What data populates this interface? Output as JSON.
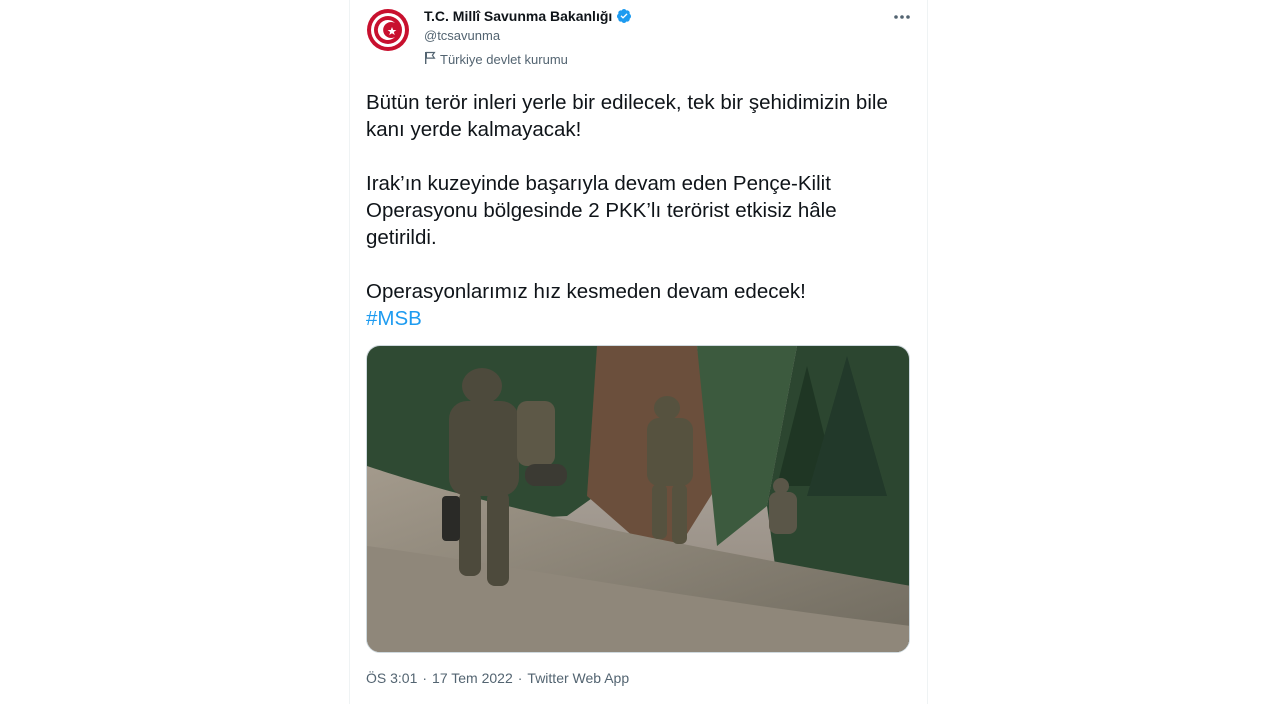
{
  "author": {
    "name": "T.C. Millî Savunma Bakanlığı",
    "handle": "@tcsavunma",
    "affiliation": "Türkiye devlet kurumu",
    "verified": true,
    "avatar_color": "#c8102e"
  },
  "tweet": {
    "paragraphs": [
      "Bütün terör inleri yerle bir edilecek, tek bir şehidimizin bile kanı yerde kalmayacak!",
      "Irak’ın kuzeyinde başarıyla devam eden Pençe-Kilit Operasyonu bölgesinde 2 PKK’lı terörist etkisiz hâle getirildi.",
      "Operasyonlarımız hız kesmeden devam edecek!"
    ],
    "hashtag": "#MSB"
  },
  "meta": {
    "time": "ÖS 3:01",
    "separator": "·",
    "date": "17 Tem 2022",
    "source": "Twitter Web App"
  },
  "colors": {
    "accent": "#1d9bf0",
    "secondary_text": "#536471"
  },
  "icons": {
    "verified": "verified-badge-icon",
    "affiliation": "flag-icon",
    "more": "more-horizontal-icon"
  }
}
